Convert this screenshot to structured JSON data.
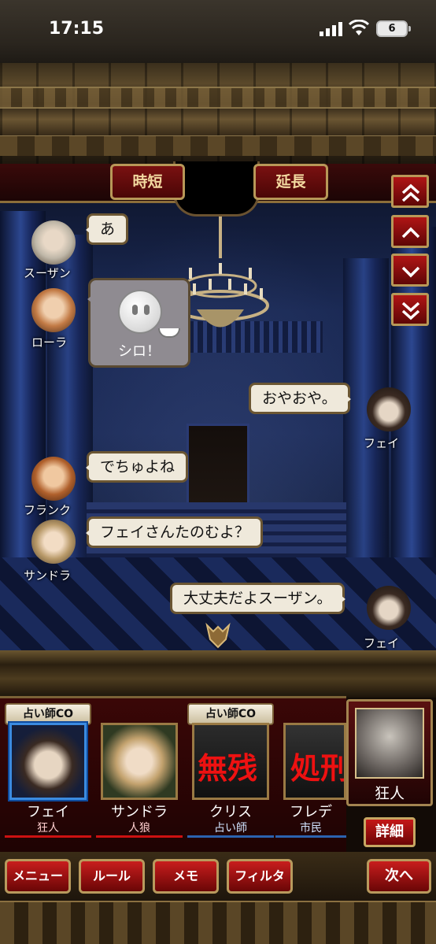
{
  "status_bar": {
    "time": "17:15",
    "battery": "6"
  },
  "top_buttons": {
    "shorten": "時短",
    "extend": "延長"
  },
  "scroll_buttons": [
    "scroll-top",
    "scroll-up",
    "scroll-down",
    "scroll-bottom"
  ],
  "chat": [
    {
      "speaker": "スーザン",
      "side": "left",
      "text": "あ"
    },
    {
      "speaker": "ローラ",
      "side": "left",
      "stamp": true,
      "text": "シロ！"
    },
    {
      "speaker": "フェイ",
      "side": "right",
      "text": "おやおや。"
    },
    {
      "speaker": "フランク",
      "side": "left",
      "text": "でちゅよね"
    },
    {
      "speaker": "サンドラ",
      "side": "left",
      "text": "フェイさんたのむよ？"
    },
    {
      "speaker": "フェイ",
      "side": "right",
      "text": "大丈夫だよスーザン。"
    }
  ],
  "players": [
    {
      "tag": "占い師CO",
      "name": "フェイ",
      "role": "狂人",
      "role_color": "red",
      "selected": true
    },
    {
      "tag": "",
      "name": "サンドラ",
      "role": "人狼",
      "role_color": "red"
    },
    {
      "tag": "占い師CO",
      "name": "クリス",
      "role": "占い師",
      "role_color": "blue",
      "overlay": "無残"
    },
    {
      "tag": "",
      "name": "フレデ",
      "role": "市民",
      "role_color": "blue",
      "overlay": "処刑"
    }
  ],
  "self": {
    "role": "狂人",
    "detail_label": "詳細"
  },
  "bottom_buttons": {
    "menu": "メニュー",
    "rule": "ルール",
    "memo": "メモ",
    "filter": "フィルタ",
    "next": "次へ"
  }
}
